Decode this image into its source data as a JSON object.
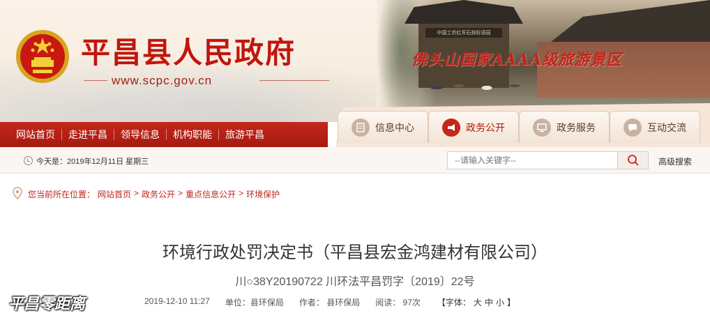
{
  "header": {
    "site_title": "平昌县人民政府",
    "site_url": "www.scpc.gov.cn",
    "scene_caption": "佛头山国家AAAA级旅游景区",
    "gate_sign": "中国工农红军石刻标语园"
  },
  "nav": {
    "items": [
      "网站首页",
      "走进平昌",
      "领导信息",
      "机构职能",
      "旅游平昌"
    ]
  },
  "tabs": [
    {
      "label": "信息中心",
      "icon": "document-icon",
      "active": false
    },
    {
      "label": "政务公开",
      "icon": "megaphone-icon",
      "active": true
    },
    {
      "label": "政务服务",
      "icon": "monitor-icon",
      "active": false
    },
    {
      "label": "互动交流",
      "icon": "chat-icon",
      "active": false
    }
  ],
  "infobar": {
    "today": "今天是：2019年12月11日 星期三",
    "search_placeholder": "--请输入关键字--",
    "advanced_search": "高级搜索"
  },
  "breadcrumb": {
    "prefix": "您当前所在位置：",
    "items": [
      "网站首页",
      "政务公开",
      "重点信息公开",
      "环境保护"
    ],
    "separator": ">"
  },
  "article": {
    "title": "环境行政处罚决定书（平昌县宏金鸿建材有限公司）",
    "subtitle": "川○38Y20190722 川环法平昌罚字〔2019〕22号",
    "date": "2019-12-10 11:27",
    "unit": "单位：县环保局",
    "author": "作者：  县环保局",
    "views": "阅读：  97次",
    "font_label": "【字体：",
    "font_sizes": [
      "大",
      "中",
      "小"
    ],
    "font_end": "】"
  },
  "watermark": "平昌零距离",
  "colors": {
    "brand_red": "#c0160d",
    "nav_red": "#b5180e",
    "breadcrumb_red": "#c3241a"
  }
}
